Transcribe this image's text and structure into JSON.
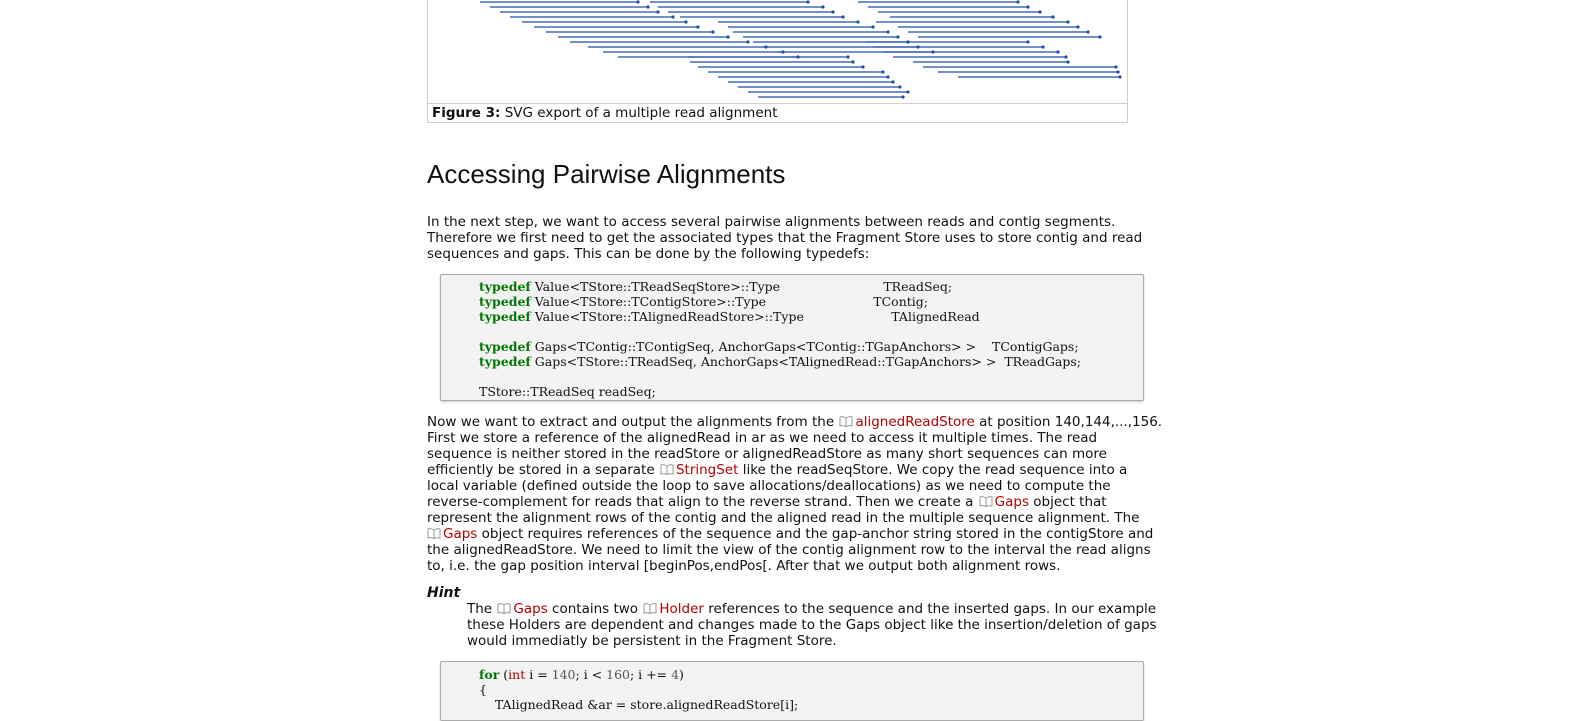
{
  "figure": {
    "caption_label": "Figure 3:",
    "caption_text": " SVG export of a multiple read alignment",
    "line_color": "#1f4fa8"
  },
  "section": {
    "heading": "Accessing Pairwise Alignments"
  },
  "intro": [
    "In the next step, we want to access several pairwise alignments between reads and contig segments.",
    "Therefore we first need to get the associated types that the Fragment Store uses to store contig and read",
    "sequences and gaps. This can be done by the following typedefs:"
  ],
  "code1": [
    {
      "kw": "typedef",
      "rest": " Value<TStore::TReadSeqStore>::Type",
      "pad": "                          ",
      "name": "TReadSeq;"
    },
    {
      "kw": "typedef",
      "rest": " Value<TStore::TContigStore>::Type",
      "pad": "                           ",
      "name": "TContig;"
    },
    {
      "kw": "typedef",
      "rest": " Value<TStore::TAlignedReadStore>::Type",
      "pad": "                      ",
      "name": "TAlignedRead"
    },
    {
      "kw": "",
      "rest": "",
      "pad": "",
      "name": ""
    },
    {
      "kw": "typedef",
      "rest": " Gaps<TContig::TContigSeq, AnchorGaps<TContig::TGapAnchors> >",
      "pad": "    ",
      "name": "TContigGaps;"
    },
    {
      "kw": "typedef",
      "rest": " Gaps<TStore::TReadSeq, AnchorGaps<TAlignedRead::TGapAnchors> >",
      "pad": "  ",
      "name": "TReadGaps;"
    },
    {
      "kw": "",
      "rest": "",
      "pad": "",
      "name": ""
    },
    {
      "kw": "",
      "rest": "TStore::TReadSeq readSeq;",
      "pad": "",
      "name": ""
    }
  ],
  "body": {
    "l1a": "Now we want to extract and output the alignments from the ",
    "l1link": "alignedReadStore",
    "l1b": " at position 140,144,...,156.",
    "l2": "First we store a reference of the alignedRead in ar as we need to access it multiple times. The read",
    "l3": "sequence is neither stored in the readStore or alignedReadStore as many short sequences can more",
    "l4a": "efficiently be stored in a separate ",
    "l4link": "StringSet",
    "l4b": " like the readSeqStore. We copy the read sequence into a",
    "l5": "local variable (defined outside the loop to save allocations/deallocations) as we need to compute the",
    "l6a": "reverse-complement for reads that align to the reverse strand. Then we create a ",
    "l6link": "Gaps",
    "l6b": " object that",
    "l7": "represent the alignment rows of the contig and the aligned read in the multiple sequence alignment. The",
    "l8link": "Gaps",
    "l8b": " object requires references of the sequence and the gap-anchor string stored in the contigStore and",
    "l9": "the alignedReadStore. We need to limit the view of the contig alignment row to the interval the read aligns",
    "l10": "to, i.e. the gap position interval [beginPos,endPos[. After that we output both alignment rows."
  },
  "hint": {
    "title": "Hint",
    "l1a": "The ",
    "l1link1": "Gaps",
    "l1b": " contains two ",
    "l1link2": "Holder",
    "l1c": " references to the sequence and the inserted gaps. In our example",
    "l2": "these Holders are dependent and changes made to the Gaps object like the insertion/deletion of gaps",
    "l3": "would immediatly be persistent in the Fragment Store."
  },
  "code2": {
    "for_kw": "for",
    "open": " (",
    "int_kw": "int",
    "decl": " i = ",
    "n1": "140",
    "mid": "; i < ",
    "n2": "160",
    "inc": "; i += ",
    "n3": "4",
    "close": ")",
    "brace": "{",
    "l3": "    TAlignedRead &ar = store.alignedReadStore[i];"
  }
}
